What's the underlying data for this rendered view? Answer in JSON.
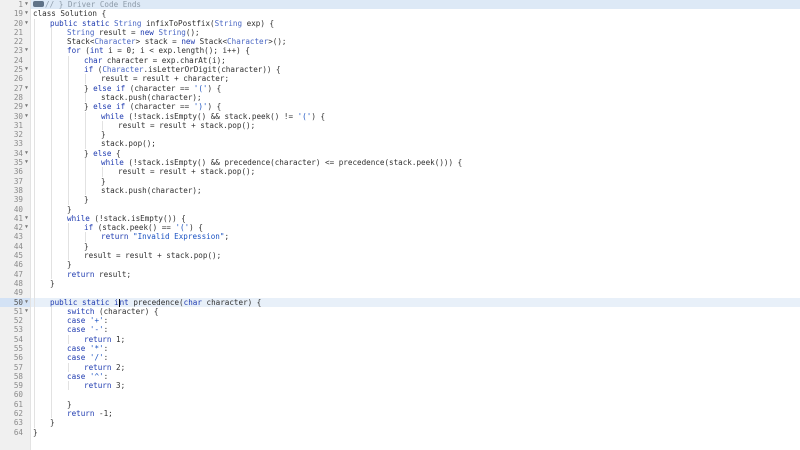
{
  "editor": {
    "language": "java",
    "cursor_line": 50,
    "lines": [
      {
        "n": "1",
        "fold": true,
        "hl": "first",
        "indent": 0,
        "tokens": [
          [
            "c",
            "// } Driver Code Ends"
          ]
        ]
      },
      {
        "n": "19",
        "fold": true,
        "indent": 0,
        "tokens": [
          [
            "n",
            "class Solution {"
          ]
        ]
      },
      {
        "n": "20",
        "fold": true,
        "indent": 1,
        "tokens": [
          [
            "k",
            "public static "
          ],
          [
            "t",
            "String"
          ],
          [
            "n",
            " infixToPostfix("
          ],
          [
            "t",
            "String"
          ],
          [
            "n",
            " exp) {"
          ]
        ]
      },
      {
        "n": "21",
        "fold": false,
        "indent": 2,
        "tokens": [
          [
            "t",
            "String"
          ],
          [
            "n",
            " result = "
          ],
          [
            "k",
            "new"
          ],
          [
            "n",
            " "
          ],
          [
            "t",
            "String"
          ],
          [
            "n",
            "();"
          ]
        ]
      },
      {
        "n": "22",
        "fold": false,
        "indent": 2,
        "tokens": [
          [
            "n",
            "Stack<"
          ],
          [
            "t",
            "Character"
          ],
          [
            "n",
            "> stack = "
          ],
          [
            "k",
            "new"
          ],
          [
            "n",
            " Stack<"
          ],
          [
            "t",
            "Character"
          ],
          [
            "n",
            ">();"
          ]
        ]
      },
      {
        "n": "23",
        "fold": true,
        "indent": 2,
        "tokens": [
          [
            "k",
            "for"
          ],
          [
            "n",
            " ("
          ],
          [
            "k",
            "int"
          ],
          [
            "n",
            " i = 0; i < exp.length(); i++) {"
          ]
        ]
      },
      {
        "n": "24",
        "fold": false,
        "indent": 3,
        "tokens": [
          [
            "k",
            "char"
          ],
          [
            "n",
            " character = exp.charAt(i);"
          ]
        ]
      },
      {
        "n": "25",
        "fold": true,
        "indent": 3,
        "tokens": [
          [
            "k",
            "if"
          ],
          [
            "n",
            " ("
          ],
          [
            "t",
            "Character"
          ],
          [
            "n",
            ".isLetterOrDigit(character)) {"
          ]
        ]
      },
      {
        "n": "26",
        "fold": false,
        "indent": 4,
        "tokens": [
          [
            "n",
            "result = result + character;"
          ]
        ]
      },
      {
        "n": "27",
        "fold": true,
        "indent": 3,
        "tokens": [
          [
            "n",
            "} "
          ],
          [
            "k",
            "else if"
          ],
          [
            "n",
            " (character == "
          ],
          [
            "s",
            "'('"
          ],
          [
            "n",
            ") {"
          ]
        ]
      },
      {
        "n": "28",
        "fold": false,
        "indent": 4,
        "tokens": [
          [
            "n",
            "stack.push(character);"
          ]
        ]
      },
      {
        "n": "29",
        "fold": true,
        "indent": 3,
        "tokens": [
          [
            "n",
            "} "
          ],
          [
            "k",
            "else if"
          ],
          [
            "n",
            " (character == "
          ],
          [
            "s",
            "')'"
          ],
          [
            "n",
            ") {"
          ]
        ]
      },
      {
        "n": "30",
        "fold": true,
        "indent": 4,
        "tokens": [
          [
            "k",
            "while"
          ],
          [
            "n",
            " (!stack.isEmpty() && stack.peek() != "
          ],
          [
            "s",
            "'('"
          ],
          [
            "n",
            ") {"
          ]
        ]
      },
      {
        "n": "31",
        "fold": false,
        "indent": 5,
        "tokens": [
          [
            "n",
            "result = result + stack.pop();"
          ]
        ]
      },
      {
        "n": "32",
        "fold": false,
        "indent": 4,
        "tokens": [
          [
            "n",
            "}"
          ]
        ]
      },
      {
        "n": "33",
        "fold": false,
        "indent": 4,
        "tokens": [
          [
            "n",
            "stack.pop();"
          ]
        ]
      },
      {
        "n": "34",
        "fold": true,
        "indent": 3,
        "tokens": [
          [
            "n",
            "} "
          ],
          [
            "k",
            "else"
          ],
          [
            "n",
            " {"
          ]
        ]
      },
      {
        "n": "35",
        "fold": true,
        "indent": 4,
        "tokens": [
          [
            "k",
            "while"
          ],
          [
            "n",
            " (!stack.isEmpty() && precedence(character) <= precedence(stack.peek())) {"
          ]
        ]
      },
      {
        "n": "36",
        "fold": false,
        "indent": 5,
        "tokens": [
          [
            "n",
            "result = result + stack.pop();"
          ]
        ]
      },
      {
        "n": "37",
        "fold": false,
        "indent": 4,
        "tokens": [
          [
            "n",
            "}"
          ]
        ]
      },
      {
        "n": "38",
        "fold": false,
        "indent": 4,
        "tokens": [
          [
            "n",
            "stack.push(character);"
          ]
        ]
      },
      {
        "n": "39",
        "fold": false,
        "indent": 3,
        "tokens": [
          [
            "n",
            "}"
          ]
        ]
      },
      {
        "n": "40",
        "fold": false,
        "indent": 2,
        "tokens": [
          [
            "n",
            "}"
          ]
        ]
      },
      {
        "n": "41",
        "fold": true,
        "indent": 2,
        "tokens": [
          [
            "k",
            "while"
          ],
          [
            "n",
            " (!stack.isEmpty()) {"
          ]
        ]
      },
      {
        "n": "42",
        "fold": true,
        "indent": 3,
        "tokens": [
          [
            "k",
            "if"
          ],
          [
            "n",
            " (stack.peek() == "
          ],
          [
            "s",
            "'('"
          ],
          [
            "n",
            ") {"
          ]
        ]
      },
      {
        "n": "43",
        "fold": false,
        "indent": 4,
        "tokens": [
          [
            "k",
            "return"
          ],
          [
            "n",
            " "
          ],
          [
            "s",
            "\"Invalid Expression\""
          ],
          [
            "n",
            ";"
          ]
        ]
      },
      {
        "n": "44",
        "fold": false,
        "indent": 3,
        "tokens": [
          [
            "n",
            "}"
          ]
        ]
      },
      {
        "n": "45",
        "fold": false,
        "indent": 3,
        "tokens": [
          [
            "n",
            "result = result + stack.pop();"
          ]
        ]
      },
      {
        "n": "46",
        "fold": false,
        "indent": 2,
        "tokens": [
          [
            "n",
            "}"
          ]
        ]
      },
      {
        "n": "47",
        "fold": false,
        "indent": 2,
        "tokens": [
          [
            "k",
            "return"
          ],
          [
            "n",
            " result;"
          ]
        ]
      },
      {
        "n": "48",
        "fold": false,
        "indent": 1,
        "tokens": [
          [
            "n",
            "}"
          ]
        ]
      },
      {
        "n": "49",
        "fold": false,
        "indent": 1,
        "tokens": []
      },
      {
        "n": "50",
        "fold": true,
        "hl": "cursor",
        "indent": 1,
        "tokens": [
          [
            "k",
            "public static "
          ],
          [
            "k",
            "i"
          ],
          [
            "cursor",
            ""
          ],
          [
            "k",
            "nt"
          ],
          [
            "n",
            " precedence("
          ],
          [
            "k",
            "char"
          ],
          [
            "n",
            " character) {"
          ]
        ]
      },
      {
        "n": "51",
        "fold": true,
        "indent": 2,
        "tokens": [
          [
            "k",
            "switch"
          ],
          [
            "n",
            " (character) {"
          ]
        ]
      },
      {
        "n": "52",
        "fold": false,
        "indent": 2,
        "tokens": [
          [
            "k",
            "case"
          ],
          [
            "n",
            " "
          ],
          [
            "s",
            "'+'"
          ],
          [
            "n",
            ":"
          ]
        ]
      },
      {
        "n": "53",
        "fold": false,
        "indent": 2,
        "tokens": [
          [
            "k",
            "case"
          ],
          [
            "n",
            " "
          ],
          [
            "s",
            "'-'"
          ],
          [
            "n",
            ":"
          ]
        ]
      },
      {
        "n": "54",
        "fold": false,
        "indent": 3,
        "tokens": [
          [
            "k",
            "return"
          ],
          [
            "n",
            " 1;"
          ]
        ]
      },
      {
        "n": "55",
        "fold": false,
        "indent": 2,
        "tokens": [
          [
            "k",
            "case"
          ],
          [
            "n",
            " "
          ],
          [
            "s",
            "'*'"
          ],
          [
            "n",
            ":"
          ]
        ]
      },
      {
        "n": "56",
        "fold": false,
        "indent": 2,
        "tokens": [
          [
            "k",
            "case"
          ],
          [
            "n",
            " "
          ],
          [
            "s",
            "'/'"
          ],
          [
            "n",
            ":"
          ]
        ]
      },
      {
        "n": "57",
        "fold": false,
        "indent": 3,
        "tokens": [
          [
            "k",
            "return"
          ],
          [
            "n",
            " 2;"
          ]
        ]
      },
      {
        "n": "58",
        "fold": false,
        "indent": 2,
        "tokens": [
          [
            "k",
            "case"
          ],
          [
            "n",
            " "
          ],
          [
            "s",
            "'^'"
          ],
          [
            "n",
            ":"
          ]
        ]
      },
      {
        "n": "59",
        "fold": false,
        "indent": 3,
        "tokens": [
          [
            "k",
            "return"
          ],
          [
            "n",
            " 3;"
          ]
        ]
      },
      {
        "n": "60",
        "fold": false,
        "indent": 2,
        "tokens": []
      },
      {
        "n": "61",
        "fold": false,
        "indent": 2,
        "tokens": [
          [
            "n",
            "}"
          ]
        ]
      },
      {
        "n": "62",
        "fold": false,
        "indent": 2,
        "tokens": [
          [
            "k",
            "return"
          ],
          [
            "n",
            " -1;"
          ]
        ]
      },
      {
        "n": "63",
        "fold": false,
        "indent": 1,
        "tokens": [
          [
            "n",
            "}"
          ]
        ]
      },
      {
        "n": "64",
        "fold": false,
        "indent": 0,
        "tokens": [
          [
            "n",
            "}"
          ]
        ]
      }
    ]
  },
  "colors": {
    "keyword": "#1f3bb0",
    "type": "#4a67c4",
    "string": "#1a52c2",
    "comment": "#8c9aa8",
    "text": "#303030",
    "gutter_bg": "#f0f0f0",
    "active_line": "#e8f0f9"
  }
}
